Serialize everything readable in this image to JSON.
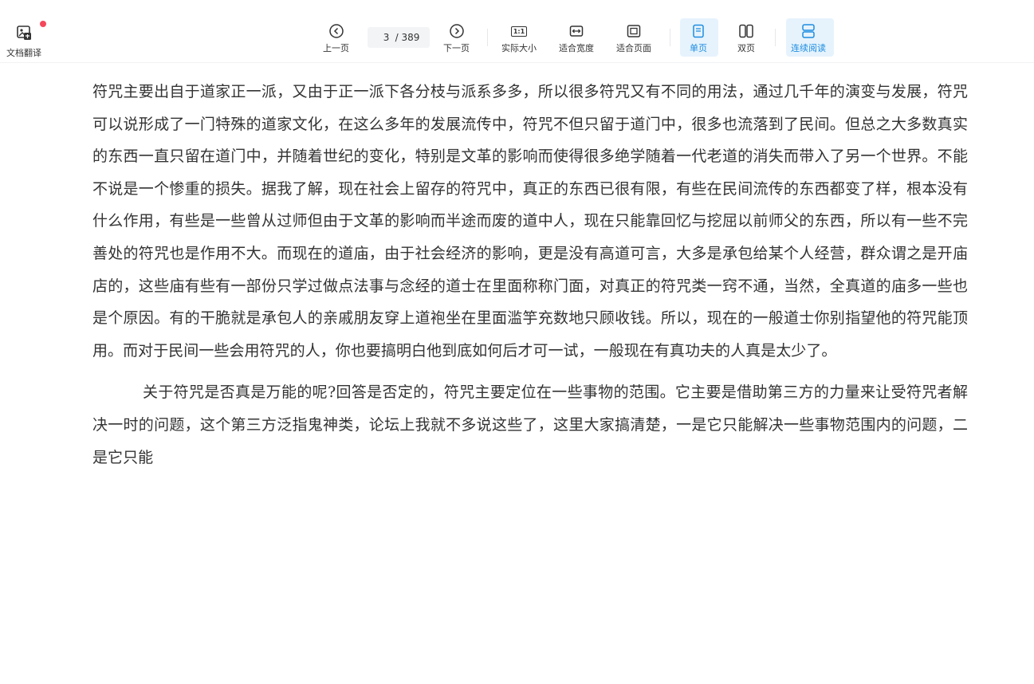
{
  "toolbar": {
    "translate_label": "文档翻译",
    "prev_label": "上一页",
    "page_current": "3",
    "page_total": "/ 389",
    "next_label": "下一页",
    "actual_size_label": "实际大小",
    "fit_width_label": "适合宽度",
    "fit_page_label": "适合页面",
    "single_page_label": "单页",
    "double_page_label": "双页",
    "continuous_label": "连续阅读",
    "actual_size_icon_text": "1:1"
  },
  "icons": {
    "translate": "translate-icon",
    "prev": "chevron-left-circle-icon",
    "next": "chevron-right-circle-icon",
    "actual_size": "actual-size-icon",
    "fit_width": "fit-width-icon",
    "fit_page": "fit-page-icon",
    "single_page": "single-page-icon",
    "double_page": "double-page-icon",
    "continuous": "continuous-scroll-icon"
  },
  "colors": {
    "accent": "#1d8ce0",
    "active_bg": "#e6f3fd",
    "badge": "#f5475c",
    "text": "#333333"
  },
  "document": {
    "paragraphs": [
      "符咒主要出自于道家正一派，又由于正一派下各分枝与派系多多，所以很多符咒又有不同的用法，通过几千年的演变与发展，符咒可以说形成了一门特殊的道家文化，在这么多年的发展流传中，符咒不但只留于道门中，很多也流落到了民间。但总之大多数真实的东西一直只留在道门中，并随着世纪的变化，特别是文革的影响而使得很多绝学随着一代老道的消失而带入了另一个世界。不能不说是一个惨重的损失。据我了解，现在社会上留存的符咒中，真正的东西已很有限，有些在民间流传的东西都变了样，根本没有什么作用，有些是一些曾从过师但由于文革的影响而半途而废的道中人，现在只能靠回忆与挖屈以前师父的东西，所以有一些不完善处的符咒也是作用不大。而现在的道庙，由于社会经济的影响，更是没有高道可言，大多是承包给某个人经营，群众谓之是开庙店的，这些庙有些有一部份只学过做点法事与念经的道士在里面称称门面，对真正的符咒类一窍不通，当然，全真道的庙多一些也是个原因。有的干脆就是承包人的亲戚朋友穿上道袍坐在里面滥竽充数地只顾收钱。所以，现在的一般道士你别指望他的符咒能顶用。而对于民间一些会用符咒的人，你也要搞明白他到底如何后才可一试，一般现在有真功夫的人真是太少了。",
      "关于符咒是否真是万能的呢?回答是否定的，符咒主要定位在一些事物的范围。它主要是借助第三方的力量来让受符咒者解决一时的问题，这个第三方泛指鬼神类，论坛上我就不多说这些了，这里大家搞清楚，一是它只能解决一些事物范围内的问题，二是它只能"
    ]
  }
}
